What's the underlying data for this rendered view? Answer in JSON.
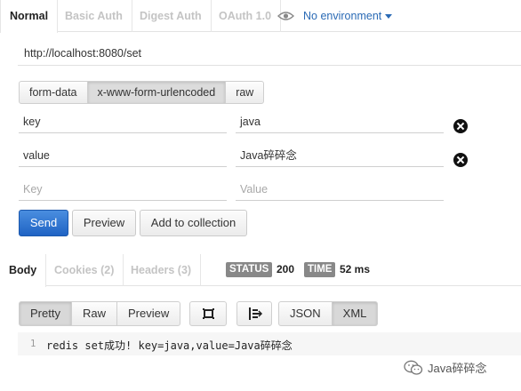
{
  "auth_tabs": [
    {
      "label": "Normal",
      "active": true
    },
    {
      "label": "Basic Auth",
      "active": false
    },
    {
      "label": "Digest Auth",
      "active": false
    },
    {
      "label": "OAuth 1.0",
      "active": false
    }
  ],
  "environment": {
    "label": "No environment",
    "icon": "eye-icon"
  },
  "url": "http://localhost:8080/set",
  "body_types": [
    {
      "label": "form-data",
      "active": false
    },
    {
      "label": "x-www-form-urlencoded",
      "active": true
    },
    {
      "label": "raw",
      "active": false
    }
  ],
  "params": [
    {
      "key": "key",
      "value": "java"
    },
    {
      "key": "value",
      "value": "Java碎碎念"
    }
  ],
  "new_param": {
    "key_placeholder": "Key",
    "value_placeholder": "Value"
  },
  "actions": {
    "send": "Send",
    "preview": "Preview",
    "add_to_collection": "Add to collection"
  },
  "response_tabs": [
    {
      "label": "Body",
      "active": true
    },
    {
      "label": "Cookies (2)",
      "active": false
    },
    {
      "label": "Headers (3)",
      "active": false
    }
  ],
  "status": {
    "label": "STATUS",
    "value": "200"
  },
  "time": {
    "label": "TIME",
    "value": "52 ms"
  },
  "view_modes": [
    {
      "label": "Pretty",
      "active": true
    },
    {
      "label": "Raw",
      "active": false
    },
    {
      "label": "Preview",
      "active": false
    }
  ],
  "format_modes": [
    {
      "label": "JSON",
      "active": false
    },
    {
      "label": "XML",
      "active": true
    }
  ],
  "response_body": {
    "line_number": "1",
    "text": "redis set成功! key=java,value=Java碎碎念"
  },
  "watermark": "Java碎碎念",
  "colors": {
    "send": "#2a6fd0",
    "link": "#2a6ab5",
    "badge": "#888888"
  }
}
